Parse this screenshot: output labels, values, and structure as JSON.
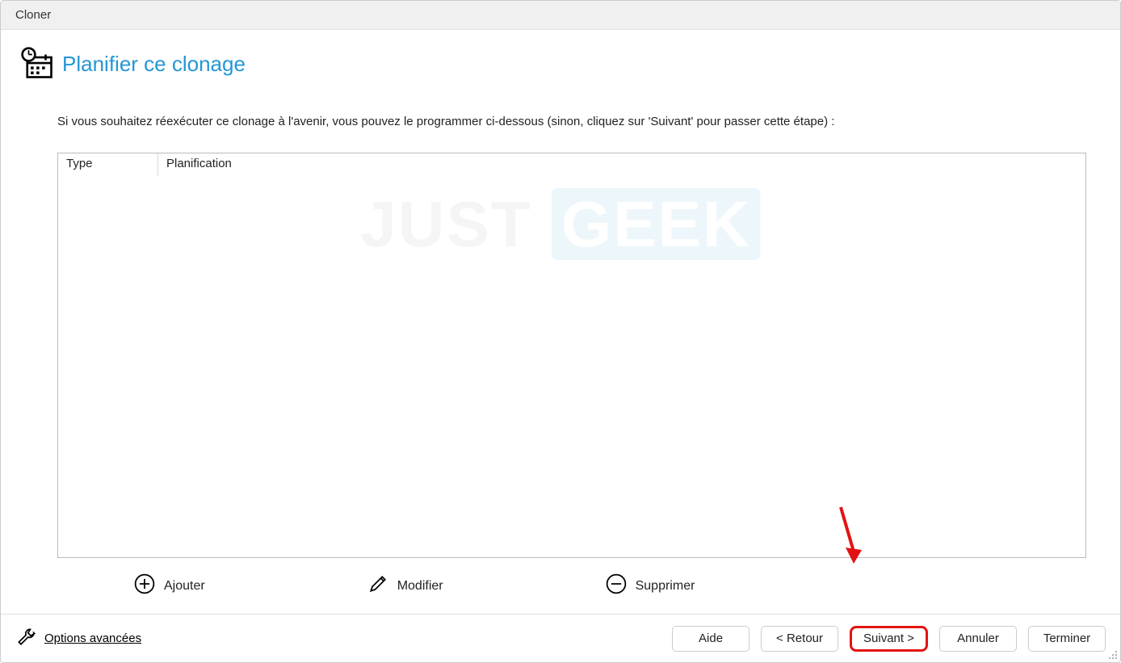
{
  "window": {
    "title": "Cloner"
  },
  "header": {
    "title": "Planifier ce clonage"
  },
  "description": "Si vous souhaitez réexécuter ce clonage à l'avenir, vous pouvez le programmer ci-dessous (sinon, cliquez sur 'Suivant' pour passer cette étape) :",
  "table": {
    "columns": {
      "type": "Type",
      "planification": "Planification"
    }
  },
  "actions": {
    "add": "Ajouter",
    "edit": "Modifier",
    "delete": "Supprimer"
  },
  "footer": {
    "advanced_options": "Options avancées",
    "help": "Aide",
    "back": "< Retour",
    "next": "Suivant >",
    "cancel": "Annuler",
    "finish": "Terminer"
  },
  "watermark": {
    "part1": "JUST",
    "part2": "GEEK"
  }
}
